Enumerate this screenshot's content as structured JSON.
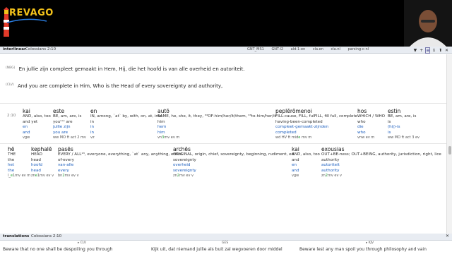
{
  "logo": {
    "text": "REVAGO"
  },
  "interlinear": {
    "title": "interlinear",
    "reference": "Colossians 2:10",
    "tabs": [
      "GNT_MS1",
      "GNT-l2",
      "ald-1-en",
      "cla.en",
      "cla.nl",
      "parsing-c-nl"
    ],
    "icons": [
      "▼",
      "+",
      "≡",
      "ℹ",
      "⬆",
      "✕"
    ],
    "versions": [
      {
        "tag": "(NBG)",
        "text": "En jullie zijn compleet gemaakt in Hem, Hij, die het hoofd is van alle overheid en autoriteit."
      },
      {
        "tag": "(CLV)",
        "text": "And you are complete in Him, Who is the Head of every sovereignty and authority,"
      }
    ],
    "verse_ref": "2:10",
    "rows": [
      [
        {
          "greek": "kai",
          "gloss1": "AND, also, too",
          "gloss2": "and yet",
          "nl": "en",
          "en": "and",
          "morph_pre": "",
          "morph_g": "",
          "morph": "vgw"
        },
        {
          "greek": "este",
          "gloss1": "BE, am, are, is",
          "gloss2": "youⁿᵃˢ are",
          "nl": "jullie zijn",
          "en": "you are",
          "morph_pre": "",
          "morph_g": "",
          "morph": "ww MO ft act 2 mv"
        },
        {
          "greek": "en",
          "gloss1": "IN, among, `at` by, with, on, at, into",
          "gloss2": "in",
          "nl": "in",
          "en": "in",
          "morph_pre": "",
          "morph_g": "",
          "morph": "vz"
        },
        {
          "greek": "autō",
          "gloss1": "SAME, he, she, it, they, ³³OF-him/her/it/them, ³³to-him/her/it",
          "gloss2": "him",
          "nl": "hem",
          "en": "him",
          "morph_pre": "vn",
          "morph_g": "3",
          "morph": "mv ev m"
        },
        {
          "greek": "peplērōmenoi",
          "gloss1": "FILL-cause, FILL, fulFILL, fill full, complete",
          "gloss2": "having-been-completed",
          "nl": "compleet-gemaakt-zijnden",
          "en": "completed",
          "morph_pre": "wd HV ft mid",
          "morph_g": "e",
          "morph": " mv m"
        },
        {
          "greek": "hos",
          "gloss1": "WHICH / WHO",
          "gloss2": "who",
          "nl": "die",
          "en": "who",
          "morph_pre": "",
          "morph_g": "",
          "morph": "vnw ev m"
        },
        {
          "greek": "estin",
          "gloss1": "BE, am, are, is",
          "gloss2": "is",
          "nl": "(hij)-is",
          "en": "is",
          "morph_pre": "",
          "morph_g": "",
          "morph": "ww MO ft act 3 ev"
        }
      ],
      [
        {
          "greek": "hē",
          "gloss1": "THE",
          "gloss2": "the",
          "nl": "het",
          "en": "the",
          "morph_pre": "l_",
          "morph_g": "e",
          "morph": "1mv ev m"
        },
        {
          "greek": "kephalē",
          "gloss1": "HEAD",
          "gloss2": "head",
          "nl": "hoofd",
          "en": "head",
          "morph_pre": "zn",
          "morph_g": "e",
          "morph": "1mv ev v"
        },
        {
          "greek": "pasēs",
          "gloss1": "EVERY / ALL¹³, everyone, everything, `at` any, anything, entire",
          "gloss2": "of-every",
          "nl": "van-alle",
          "en": "every",
          "morph_pre": "bn",
          "morph_g": "2",
          "morph": "mv ev v"
        },
        {
          "greek": "archēs",
          "gloss1": "ORIGINAL, origin, chief, sovereignty, beginning, rudiment, ed",
          "gloss2": "sovereignty",
          "nl": "overheid",
          "en": "sovereignty",
          "morph_pre": "zn",
          "morph_g": "2",
          "morph": "mv ev v"
        },
        {
          "greek": "kai",
          "gloss1": "AND, also, too",
          "gloss2": "and",
          "nl": "en",
          "en": "and",
          "morph_pre": "",
          "morph_g": "",
          "morph": "vgw"
        },
        {
          "greek": "exousias",
          "gloss1": "OUT+BE-ness; OUT+BEING, authority, jurisdiction, right, lice",
          "gloss2": "authority",
          "nl": "autoriteit",
          "en": "authority",
          "morph_pre": "zn",
          "morph_g": "2",
          "morph": "mv ev v"
        }
      ]
    ]
  },
  "translations": {
    "title": "translations",
    "reference": "Colossians 2:10",
    "columns": [
      "▸ CLV",
      "GES",
      "▸ KJV"
    ],
    "lines": [
      "Beware that no one shall be despoiling you through",
      "Kijk uit, dat niemand jullie als buit zal wegvoeren door middel",
      "Beware lest any man spoil you through philosophy and vain"
    ]
  },
  "colors": {
    "accent": "#1c5fbf",
    "morph_green": "#1a9e2c",
    "logo_yellow": "#f3c21a"
  }
}
